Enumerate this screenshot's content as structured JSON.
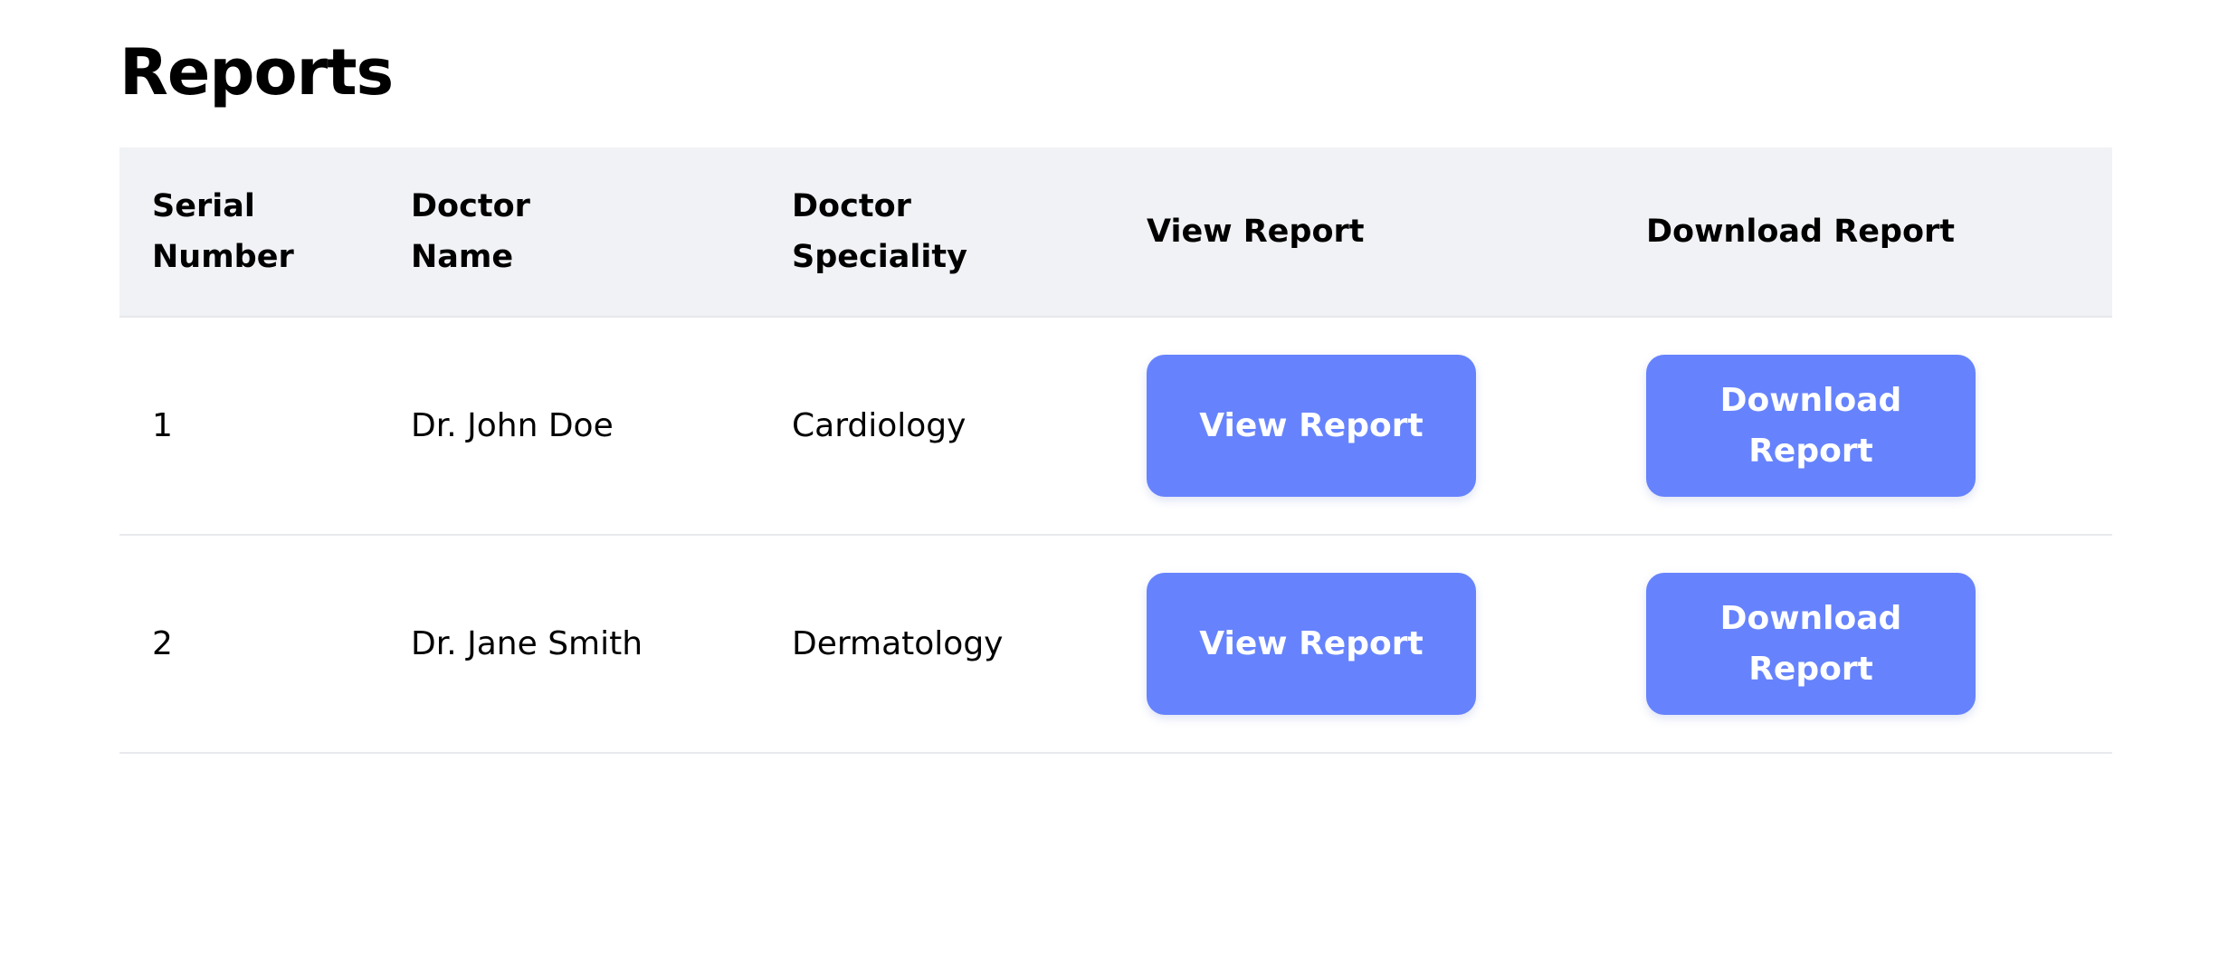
{
  "page": {
    "title": "Reports"
  },
  "table": {
    "headers": {
      "serial": "Serial Number",
      "doctor_name": "Doctor Name",
      "speciality": "Doctor Speciality",
      "view": "View Report",
      "download": "Download Report"
    },
    "rows": [
      {
        "serial": "1",
        "doctor_name": "Dr. John Doe",
        "speciality": "Cardiology",
        "view_label": "View Report",
        "download_label": "Download Report"
      },
      {
        "serial": "2",
        "doctor_name": "Dr. Jane Smith",
        "speciality": "Dermatology",
        "view_label": "View Report",
        "download_label": "Download Report"
      }
    ]
  },
  "colors": {
    "button_bg": "#6683fd",
    "header_bg": "#f1f2f5",
    "button_text": "#ffffff"
  }
}
